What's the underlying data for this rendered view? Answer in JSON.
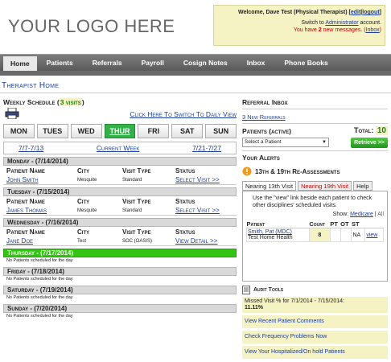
{
  "logo": "YOUR LOGO HERE",
  "welcome": {
    "line1_prefix": "Welcome, Dave Test (Physical Therapist)",
    "edit": "edit",
    "logout": "logout",
    "line2_prefix": "Switch to",
    "line2_link": "Administrator",
    "line2_suffix": "account.",
    "line3_prefix": "You have",
    "line3_count": "2",
    "line3_suffix": "new messages.",
    "inbox": "Inbox"
  },
  "nav": [
    "Home",
    "Patients",
    "Referrals",
    "Payroll",
    "Cosign Notes",
    "Inbox",
    "Phone Books"
  ],
  "page_title": "Therapist Home",
  "schedule": {
    "title": "Weekly Schedule",
    "count": "3 visits",
    "switch_link": "Click Here To Switch To Daily View",
    "days": [
      "MON",
      "TUES",
      "WED",
      "THUR",
      "FRI",
      "SAT",
      "SUN"
    ],
    "active_day": "THUR",
    "prev_week": "7/7-7/13",
    "current_week": "Current Week",
    "next_week": "7/21-7/27",
    "columns": [
      "Patient Name",
      "City",
      "Visit Type",
      "Status"
    ],
    "no_patients": "No Patients scheduled for the day",
    "day_blocks": [
      {
        "label": "Monday - (7/14/2014)",
        "patient": "John Smith",
        "city": "Mesquite",
        "visit": "Standard",
        "status": "Select Visit >>"
      },
      {
        "label": "Tuesday - (7/15/2014)",
        "patient": "James Thomas",
        "city": "Mesquite",
        "visit": "Standard",
        "status": "Select Visit >>"
      },
      {
        "label": "Wednesday - (7/16/2014)",
        "patient": "Jane Doe",
        "city": "Test",
        "visit": "SOC (OASIS)",
        "status": "View Detail >>"
      }
    ],
    "empty_days": [
      "Thursday - (7/17/2014)",
      "Friday - (7/18/2014)",
      "Saturday - (7/19/2014)",
      "Sunday - (7/20/2014)"
    ]
  },
  "referral": {
    "title": "Referral Inbox",
    "link": "3 New Referrals"
  },
  "patients_active": {
    "title": "Patients (active)",
    "total_label": "Total:",
    "total": "10",
    "select_placeholder": "Select a Patient",
    "retrieve": "Retrieve >>"
  },
  "alerts": {
    "title": "Your Alerts",
    "rea_title": "13th & 19th Re-Assessments",
    "tab1": "Nearing 13th Visit",
    "tab2": "Nearing 19th Visit",
    "tab3": "Help",
    "message": "Use the \"view\" link beside each patient to check other disciplines' scheduled visits.",
    "show_label": "Show:",
    "show_medicare": "Medicare",
    "show_all": "All",
    "table_headers": [
      "Patient",
      "Count",
      "PT",
      "OT",
      "ST",
      ""
    ],
    "row": {
      "patient": "Smith, Pat (MDC)",
      "extra": "Test Home Health",
      "count": "8",
      "pt": "",
      "ot": "",
      "st": "NA",
      "view": "view"
    }
  },
  "audit": {
    "title": "Audit Tools",
    "missed_label": "Missed Visit % for 7/1/2014 - 7/15/2014:",
    "missed_value": "11.11%",
    "links": [
      "View Recent Patient Comments",
      "Check Frequency Problems Now",
      "View Your Hospitalized/On hold Patients"
    ]
  }
}
